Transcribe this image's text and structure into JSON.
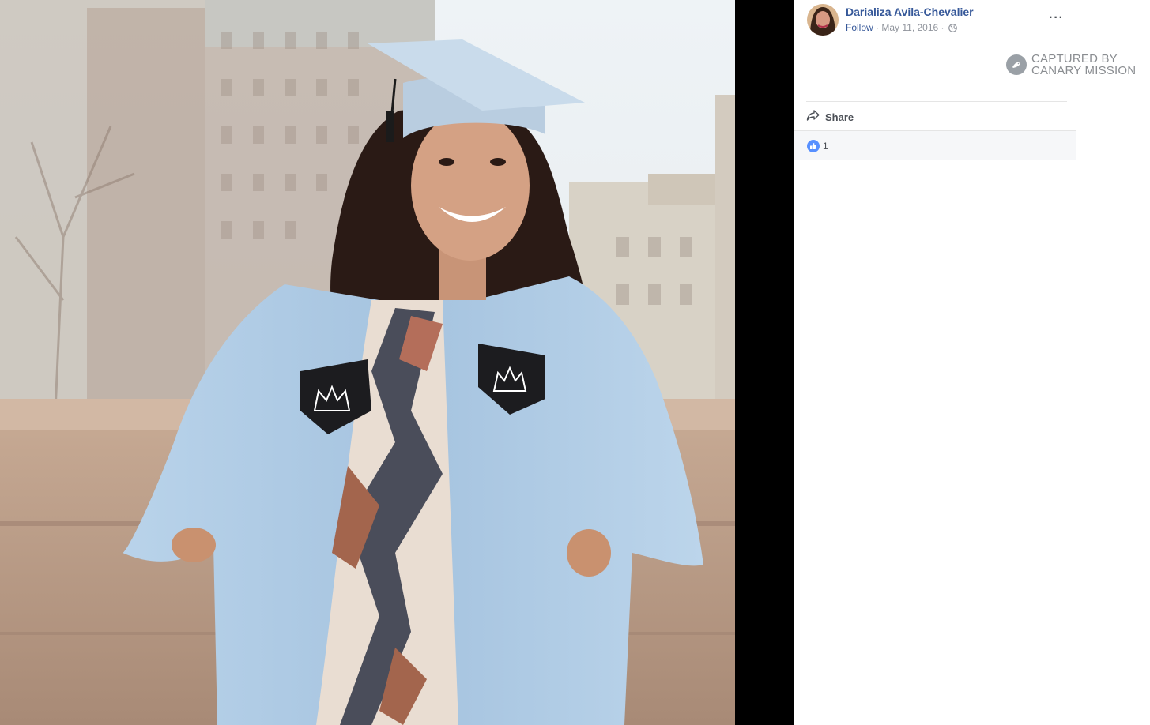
{
  "post": {
    "author": "Darializa Avila-Chevalier",
    "follow_label": "Follow",
    "date": "May 11, 2016",
    "separator": " · ",
    "more_label": "···"
  },
  "watermark": {
    "line1": "CAPTURED BY",
    "line2": "CANARY MISSION"
  },
  "actions": {
    "share_label": "Share"
  },
  "reactions": {
    "like_count": "1"
  },
  "colors": {
    "link": "#365899",
    "meta": "#90949c",
    "like": "#5890ff",
    "gown": "#a9c6e0"
  },
  "icons": [
    "globe-icon",
    "more-options-icon",
    "canary-mission-icon",
    "share-arrow-icon",
    "like-reaction-icon"
  ]
}
